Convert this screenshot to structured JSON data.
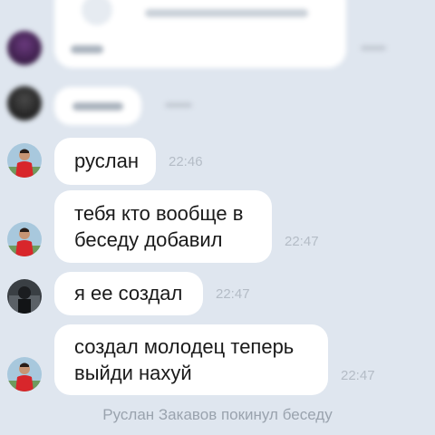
{
  "messages": [
    {
      "text": "руслан",
      "time": "22:46"
    },
    {
      "text": "тебя кто вообще в\nбеседу добавил",
      "time": "22:47"
    },
    {
      "text": "я ее создал",
      "time": "22:47"
    },
    {
      "text": "создал молодец теперь\nвыйди нахуй",
      "time": "22:47"
    }
  ],
  "system_message": "Руслан Закавов покинул беседу",
  "colors": {
    "background": "#dfe6ef",
    "bubble": "#ffffff",
    "time": "#b4bcc6",
    "system_text": "#9aa3ae"
  },
  "icons": [
    "user-avatar-red-shirt",
    "user-avatar-dark"
  ]
}
